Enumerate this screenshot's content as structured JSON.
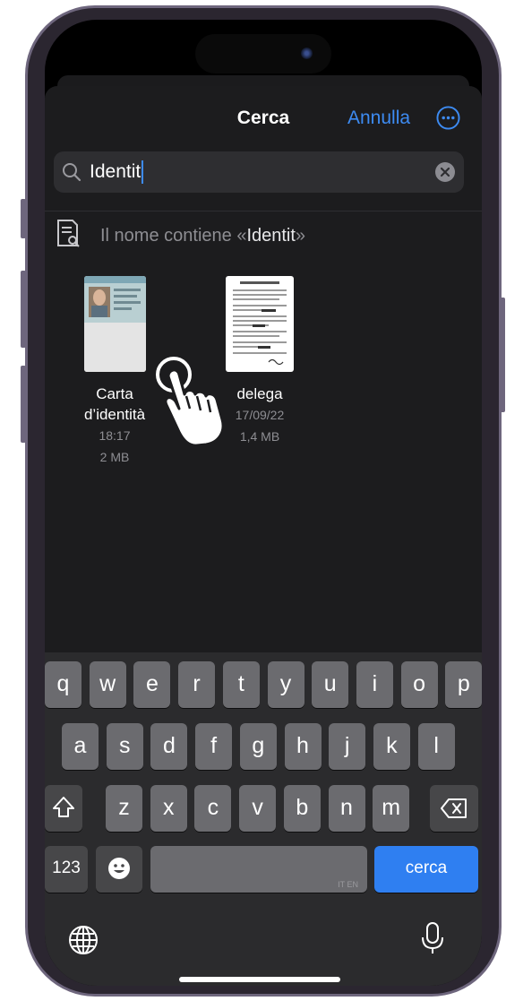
{
  "header": {
    "title": "Cerca",
    "cancel_label": "Annulla",
    "more_icon": "ellipsis-circle-icon"
  },
  "search": {
    "value": "Identit",
    "clear_icon": "xmark-circle-icon",
    "search_icon": "magnifier-icon"
  },
  "filter": {
    "prefix": "Il nome contiene «",
    "term": "Identit",
    "suffix": "»"
  },
  "files": [
    {
      "name_line1": "Carta",
      "name_line2": "d’identità",
      "date": "18:17",
      "size": "2 MB"
    },
    {
      "name": "delega",
      "date": "17/09/22",
      "size": "1,4 MB"
    }
  ],
  "keyboard": {
    "row1": [
      "q",
      "w",
      "e",
      "r",
      "t",
      "y",
      "u",
      "i",
      "o",
      "p"
    ],
    "row2": [
      "a",
      "s",
      "d",
      "f",
      "g",
      "h",
      "j",
      "k",
      "l"
    ],
    "row3": [
      "z",
      "x",
      "c",
      "v",
      "b",
      "n",
      "m"
    ],
    "numbers_label": "123",
    "space_tag": "IT EN",
    "go_label": "cerca"
  },
  "colors": {
    "accent": "#3d8bf2",
    "sheet": "#1c1c1e",
    "key": "#6b6b6f"
  }
}
